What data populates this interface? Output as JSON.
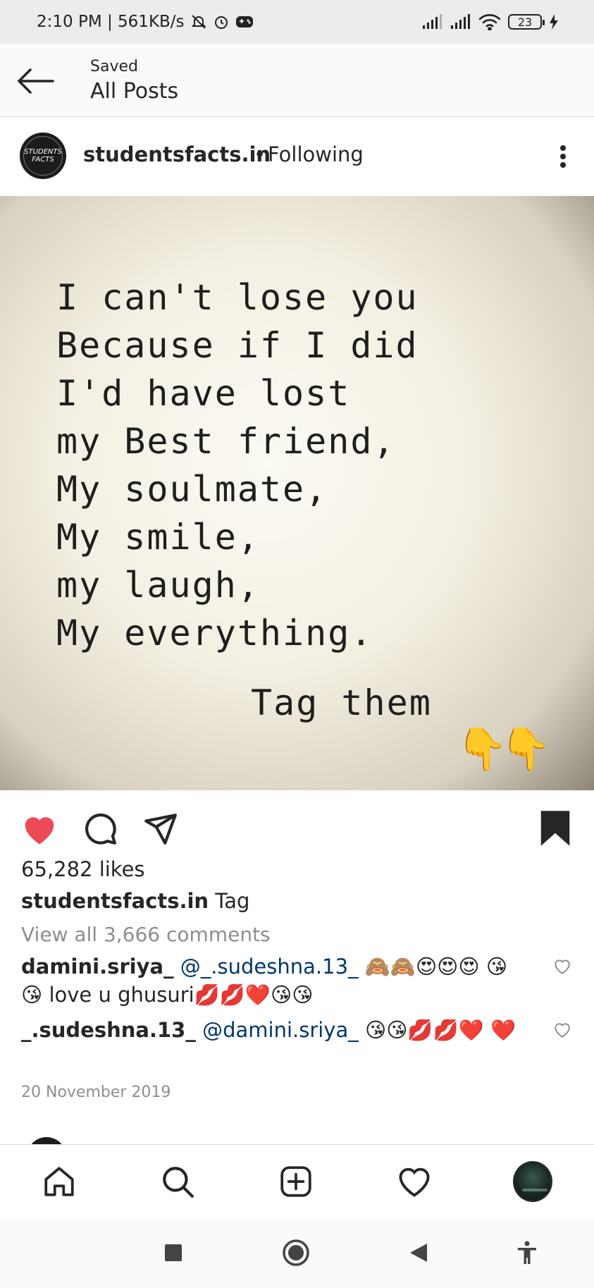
{
  "status_bar": {
    "time_speed": "2:10 PM | 561KB/s",
    "battery": "23"
  },
  "header": {
    "subtitle": "Saved",
    "title": "All Posts"
  },
  "post": {
    "username": "studentsfacts.in",
    "separator": "•",
    "follow_state": "Following",
    "avatar_text": "STUDENTS FACTS",
    "image_lines": [
      "I can't lose you",
      "Because if I did",
      "I'd have lost",
      "my Best friend,",
      "My soulmate,",
      "My smile,",
      "my laugh,",
      "My everything."
    ],
    "image_tag": "Tag them",
    "likes": "65,282 likes",
    "caption_user": "studentsfacts.in",
    "caption_text": "Tag",
    "view_comments": "View all 3,666 comments",
    "comments": [
      {
        "user": "damini.sriya_",
        "mention": "@_.sudeshna.13_",
        "text": "🙈🙈😍😍😍 😘😘 love u ghusuri💋💋❤️😘😘"
      },
      {
        "user": "_.sudeshna.13_",
        "mention": "@damini.sriya_",
        "text": "😘😘💋💋❤️ ❤️"
      }
    ],
    "date": "20 November 2019"
  },
  "colors": {
    "like_active": "#ed4956",
    "mention": "#00376b",
    "muted": "#8e8e8e"
  },
  "icons": {
    "back": "arrow-left-icon",
    "more": "more-vertical-icon",
    "like": "heart-filled-icon",
    "comment": "comment-icon",
    "share": "paper-plane-icon",
    "save": "bookmark-filled-icon",
    "home": "home-icon",
    "search": "search-icon",
    "add": "add-post-icon",
    "activity": "heart-outline-icon"
  }
}
